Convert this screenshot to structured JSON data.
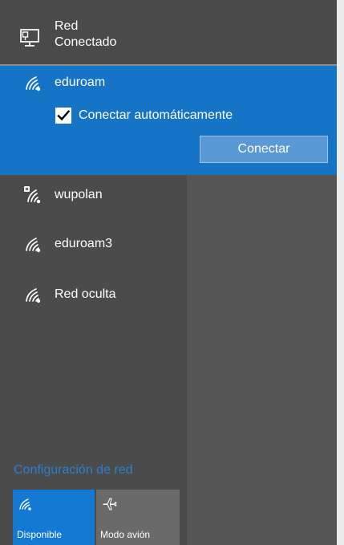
{
  "header": {
    "line1": "Red",
    "line2": "Conectado",
    "icon": "monitor-network-icon"
  },
  "networks": [
    {
      "name": "eduroam",
      "icon": "wifi-signal-icon",
      "selected": true
    },
    {
      "name": "wupolan",
      "icon": "wifi-secured-icon",
      "selected": false
    },
    {
      "name": "eduroam3",
      "icon": "wifi-signal-icon",
      "selected": false
    },
    {
      "name": "Red oculta",
      "icon": "wifi-signal-icon",
      "selected": false
    }
  ],
  "selected_network": {
    "auto_connect_label": "Conectar automáticamente",
    "auto_connect_checked": true,
    "connect_label": "Conectar"
  },
  "settings_link": "Configuración de red",
  "quick_actions": [
    {
      "label": "Disponible",
      "icon": "wifi-icon",
      "active": true
    },
    {
      "label": "Modo avión",
      "icon": "airplane-icon",
      "active": false
    }
  ],
  "colors": {
    "background": "#4b4b4b",
    "selected": "#1674c7",
    "button": "#5b99d4",
    "link": "#2a7fd0",
    "active_tile": "#1379d3",
    "inactive_tile": "#6a6a6a"
  }
}
